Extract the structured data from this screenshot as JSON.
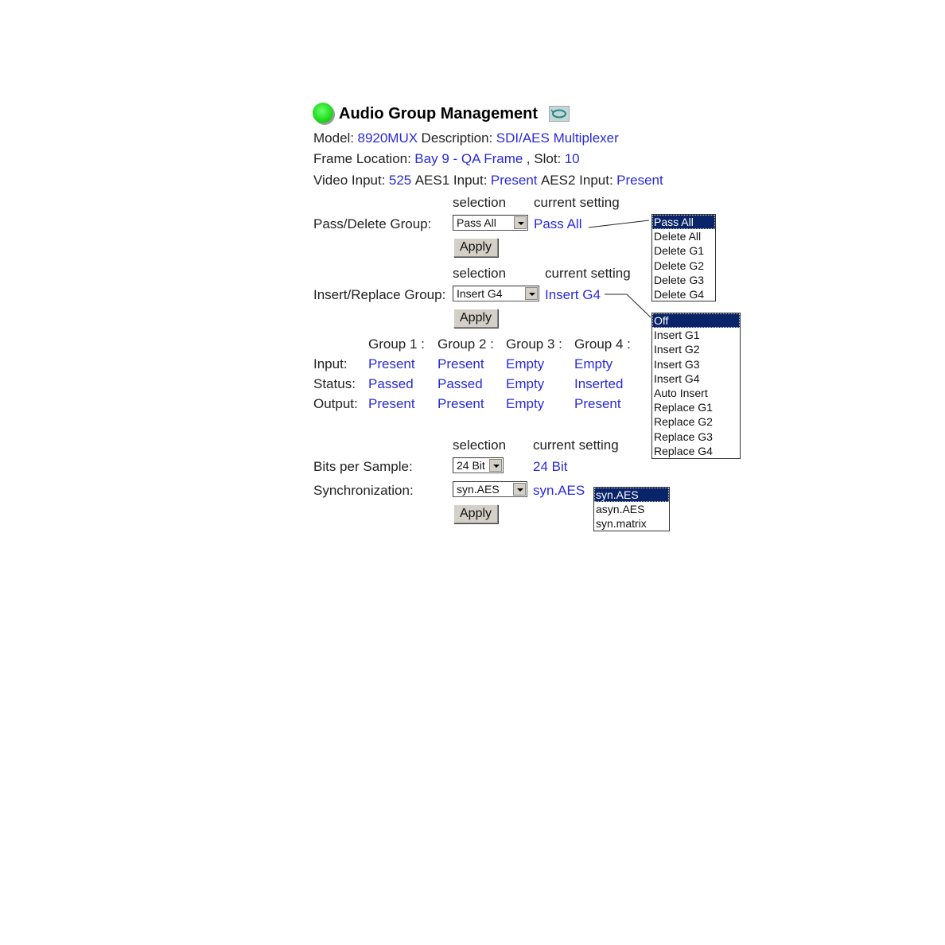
{
  "header": {
    "title": "Audio Group Management",
    "status_icon": "green-status-led-icon",
    "refresh_icon": "refresh-icon"
  },
  "info": {
    "model_label": "Model:",
    "model_value": "8920MUX",
    "description_label": "Description:",
    "description_value": "SDI/AES Multiplexer",
    "frame_location_label": "Frame Location:",
    "frame_location_value": "Bay 9 - QA Frame",
    "slot_label": ", Slot:",
    "slot_value": "10",
    "video_input_label": "Video Input:",
    "video_input_value": "525",
    "aes1_label": "AES1 Input:",
    "aes1_value": "Present",
    "aes2_label": "AES2 Input:",
    "aes2_value": "Present"
  },
  "column_headers": {
    "selection": "selection",
    "current_setting": "current setting"
  },
  "pass_delete": {
    "label": "Pass/Delete Group:",
    "selected": "Pass All",
    "current": "Pass All",
    "apply_label": "Apply",
    "options": [
      "Pass All",
      "Delete All",
      "Delete G1",
      "Delete G2",
      "Delete G3",
      "Delete G4"
    ]
  },
  "insert_replace": {
    "label": "Insert/Replace Group:",
    "selected": "Insert G4",
    "current": "Insert G4",
    "apply_label": "Apply",
    "options": [
      "Off",
      "Insert G1",
      "Insert G2",
      "Insert G3",
      "Insert G4",
      "Auto Insert",
      "Replace G1",
      "Replace G2",
      "Replace G3",
      "Replace G4"
    ]
  },
  "groups": {
    "headers": [
      "Group 1 :",
      "Group 2 :",
      "Group 3 :",
      "Group 4 :"
    ],
    "rows": [
      {
        "label": "Input:",
        "values": [
          "Present",
          "Present",
          "Empty",
          "Empty"
        ]
      },
      {
        "label": "Status:",
        "values": [
          "Passed",
          "Passed",
          "Empty",
          "Inserted"
        ]
      },
      {
        "label": "Output:",
        "values": [
          "Present",
          "Present",
          "Empty",
          "Present"
        ]
      }
    ]
  },
  "bits": {
    "label": "Bits per Sample:",
    "selected": "24 Bit",
    "current": "24 Bit"
  },
  "sync": {
    "label": "Synchronization:",
    "selected": "syn.AES",
    "current": "syn.AES",
    "apply_label": "Apply",
    "options": [
      "syn.AES",
      "asyn.AES",
      "syn.matrix"
    ]
  },
  "colors": {
    "value_text": "#2a2ad8",
    "list_highlight": "#0a246a",
    "status_led": "#22dd22"
  }
}
